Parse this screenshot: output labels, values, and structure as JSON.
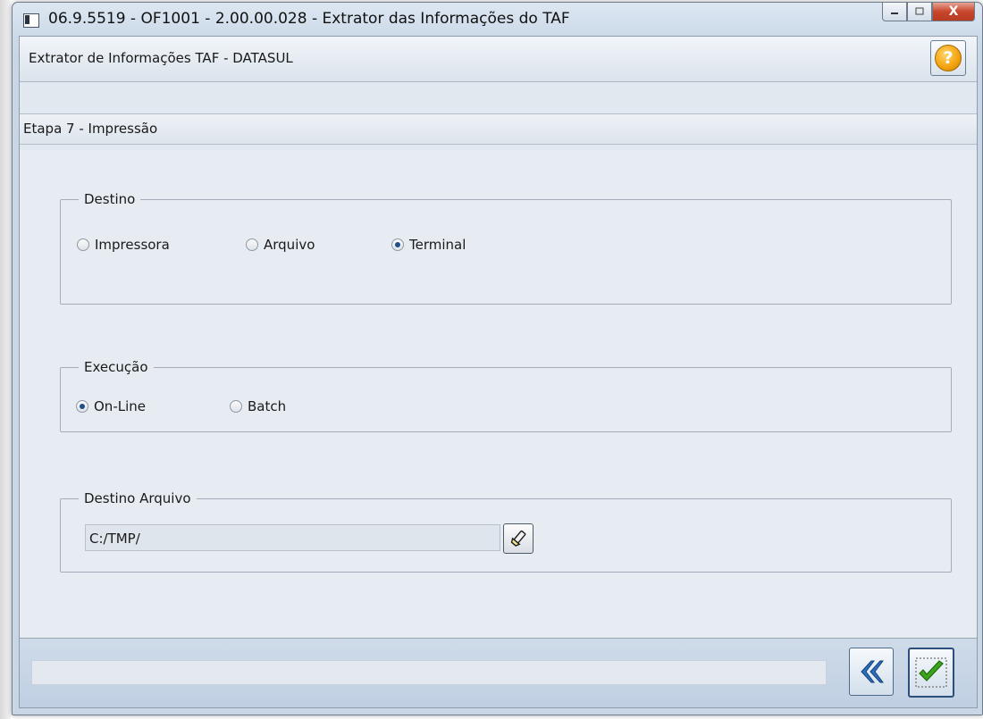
{
  "window": {
    "title": "06.9.5519 - OF1001 - 2.00.00.028 - Extrator das Informações do TAF",
    "controls": {
      "minimize_icon": "minimize-icon",
      "maximize_icon": "maximize-icon",
      "close_label": "X"
    }
  },
  "header": {
    "title": "Extrator de Informações TAF - DATASUL",
    "help_label": "?"
  },
  "step": {
    "label": "Etapa 7 - Impressão"
  },
  "destino": {
    "legend": "Destino",
    "options": [
      {
        "label": "Impressora",
        "selected": false
      },
      {
        "label": "Arquivo",
        "selected": false
      },
      {
        "label": "Terminal",
        "selected": true
      }
    ]
  },
  "execucao": {
    "legend": "Execução",
    "options": [
      {
        "label": "On-Line",
        "selected": true
      },
      {
        "label": "Batch",
        "selected": false
      }
    ]
  },
  "destino_arquivo": {
    "legend": "Destino Arquivo",
    "path": "C:/TMP/",
    "browse_icon": "flashlight-search-icon"
  },
  "footer": {
    "status_text": "",
    "back_icon": "double-left-arrow-icon",
    "confirm_icon": "checkmark-icon"
  },
  "colors": {
    "title_bar": "#cbd9e8",
    "content_bg": "#e7ecf2",
    "close_button": "#c7462c",
    "help_icon": "#f3a10c",
    "back_arrow": "#2a6fc4",
    "confirm_check": "#3aa41c"
  }
}
